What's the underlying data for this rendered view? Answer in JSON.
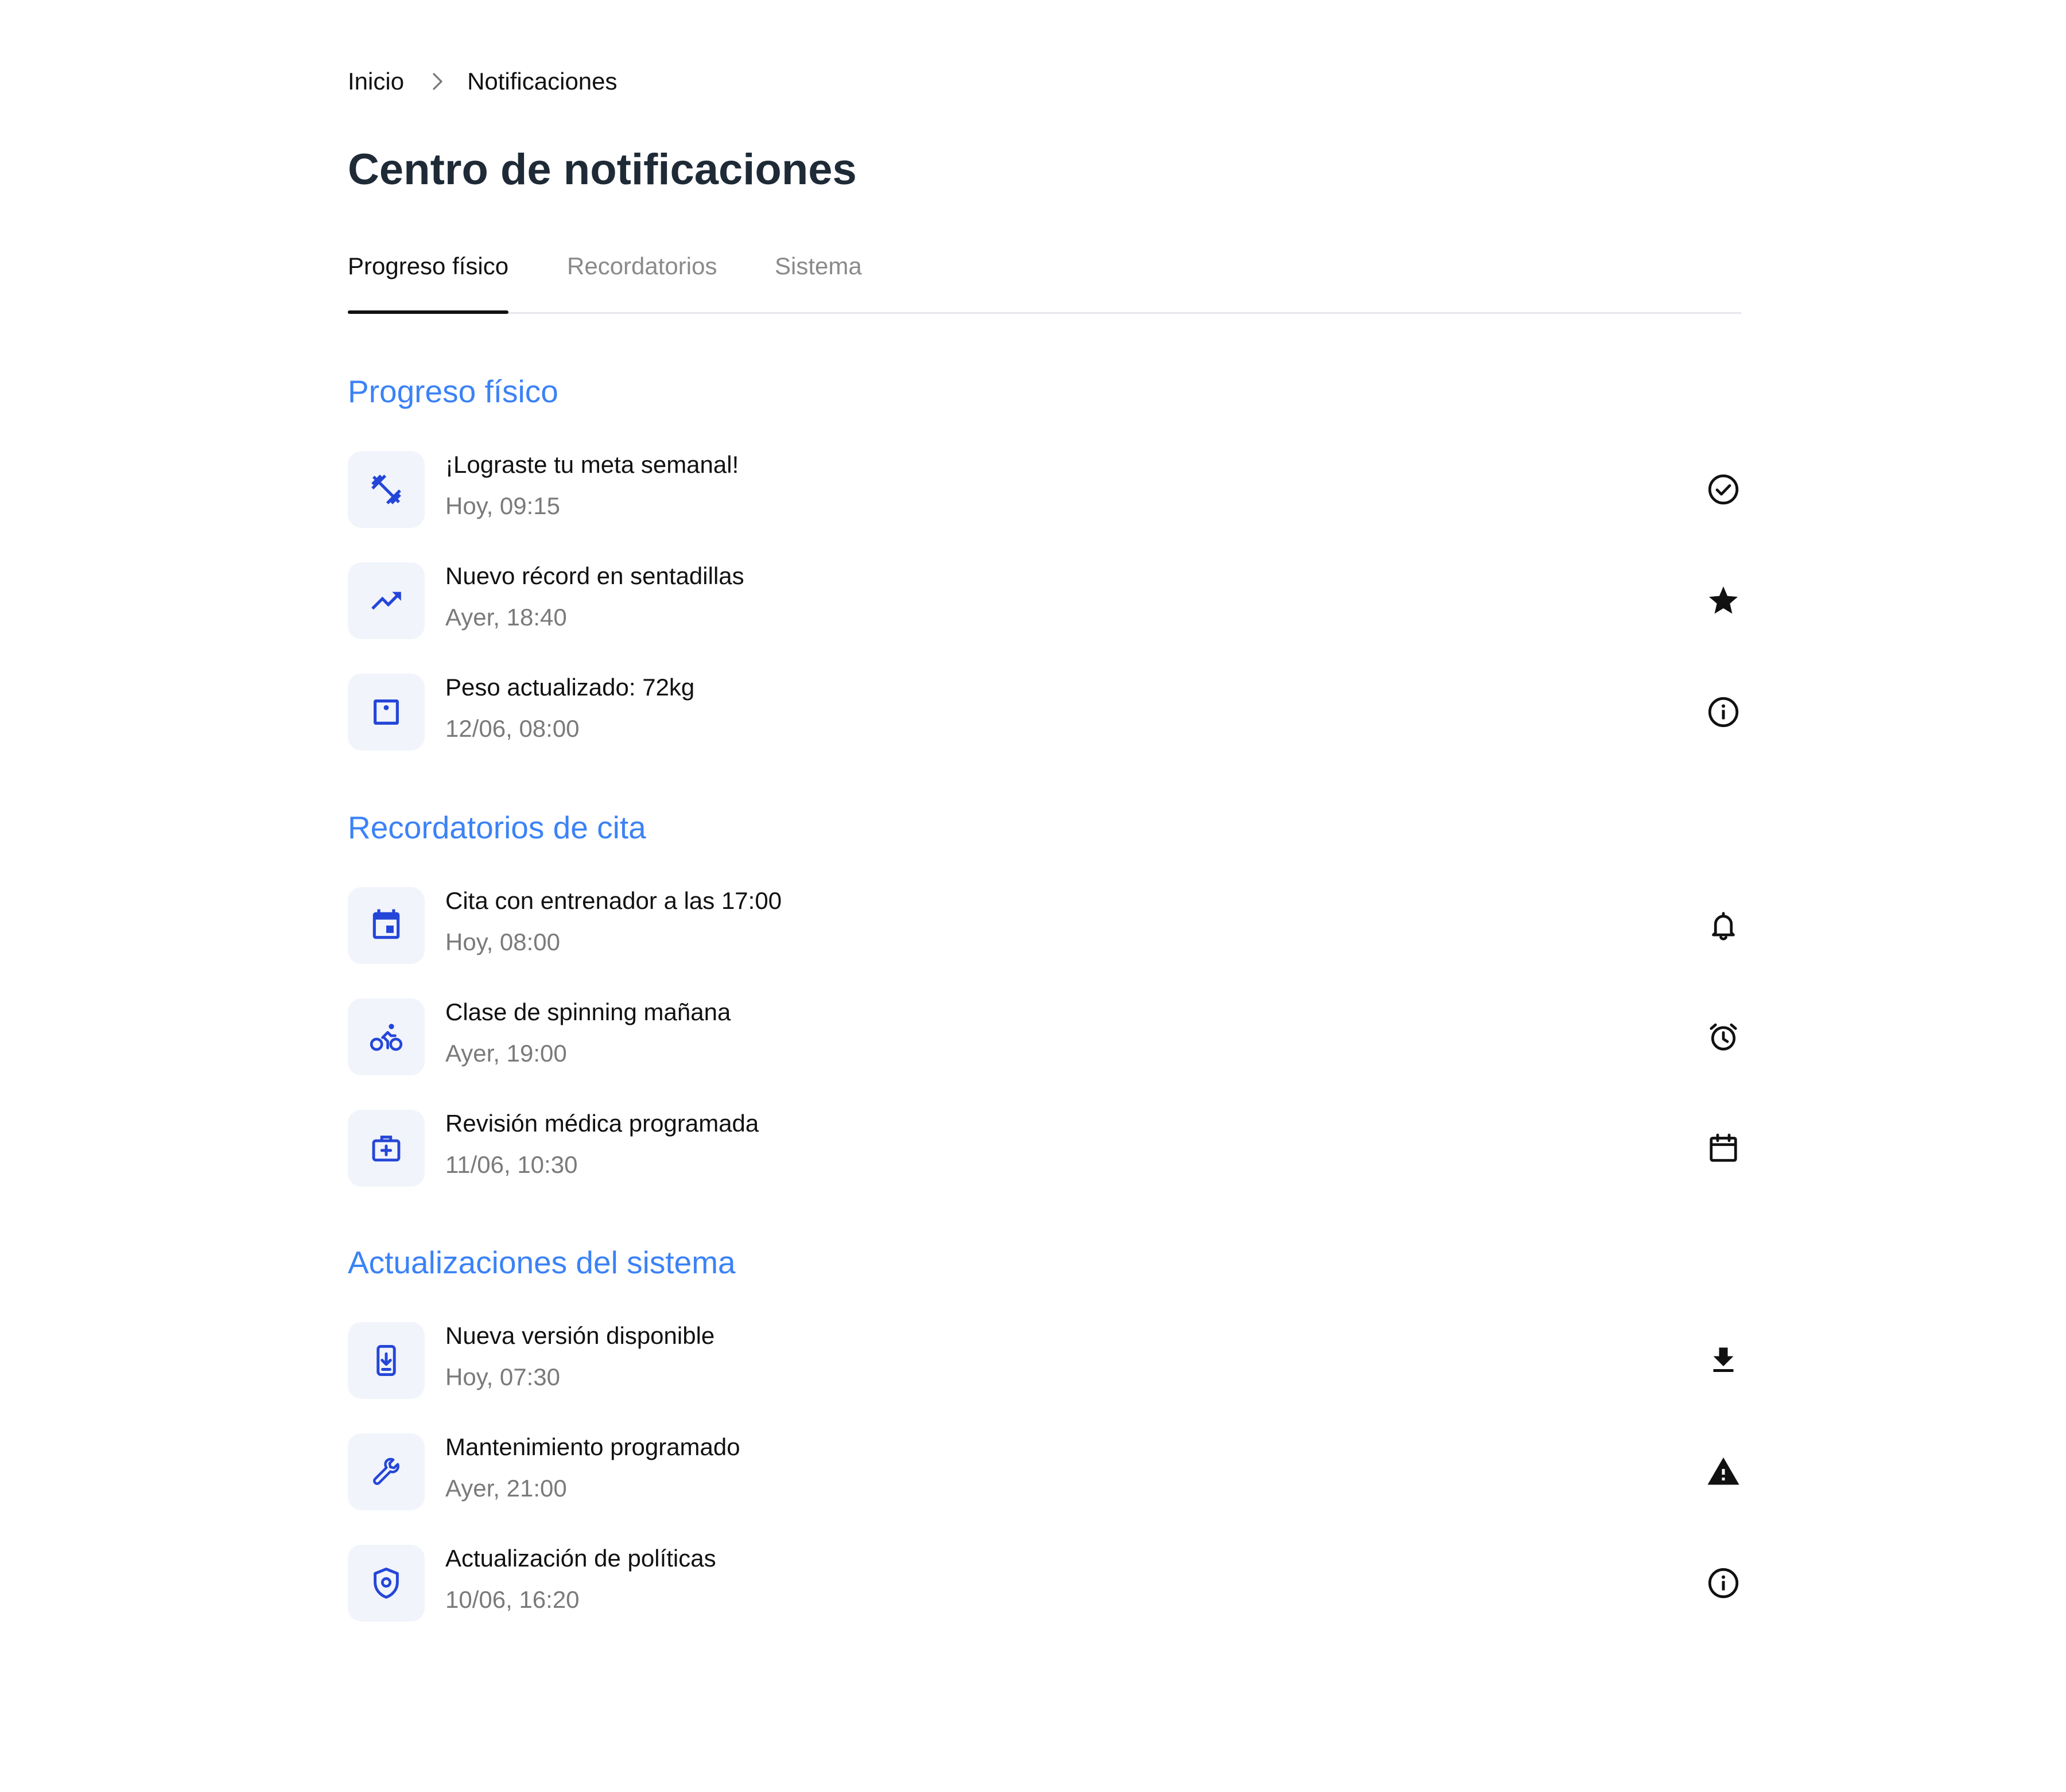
{
  "breadcrumb": {
    "home": "Inicio",
    "current": "Notificaciones"
  },
  "page": {
    "title": "Centro de notificaciones"
  },
  "tabs": [
    {
      "label": "Progreso físico",
      "active": true
    },
    {
      "label": "Recordatorios",
      "active": false
    },
    {
      "label": "Sistema",
      "active": false
    }
  ],
  "colors": {
    "accent": "#3b82f6",
    "icon_blue": "#2446d8",
    "icon_bg": "#f1f4fb",
    "muted": "#7a7a7a"
  },
  "sections": [
    {
      "title": "Progreso físico",
      "items": [
        {
          "title": "¡Lograste tu meta semanal!",
          "time": "Hoy, 09:15",
          "icon": "dumbbell-icon",
          "action_icon": "check-circle-icon"
        },
        {
          "title": "Nuevo récord en sentadillas",
          "time": "Ayer, 18:40",
          "icon": "trending-up-icon",
          "action_icon": "star-icon"
        },
        {
          "title": "Peso actualizado: 72kg",
          "time": "12/06, 08:00",
          "icon": "scale-icon",
          "action_icon": "info-icon"
        }
      ]
    },
    {
      "title": "Recordatorios de cita",
      "items": [
        {
          "title": "Cita con entrenador a las 17:00",
          "time": "Hoy, 08:00",
          "icon": "calendar-event-icon",
          "action_icon": "bell-icon"
        },
        {
          "title": "Clase de spinning mañana",
          "time": "Ayer, 19:00",
          "icon": "bike-icon",
          "action_icon": "alarm-icon"
        },
        {
          "title": "Revisión médica programada",
          "time": "11/06, 10:30",
          "icon": "medical-bag-icon",
          "action_icon": "calendar-icon"
        }
      ]
    },
    {
      "title": "Actualizaciones del sistema",
      "items": [
        {
          "title": "Nueva versión disponible",
          "time": "Hoy, 07:30",
          "icon": "phone-download-icon",
          "action_icon": "download-icon"
        },
        {
          "title": "Mantenimiento programado",
          "time": "Ayer, 21:00",
          "icon": "wrench-icon",
          "action_icon": "warning-icon"
        },
        {
          "title": "Actualización de políticas",
          "time": "10/06, 16:20",
          "icon": "shield-icon",
          "action_icon": "info-icon"
        }
      ]
    }
  ]
}
